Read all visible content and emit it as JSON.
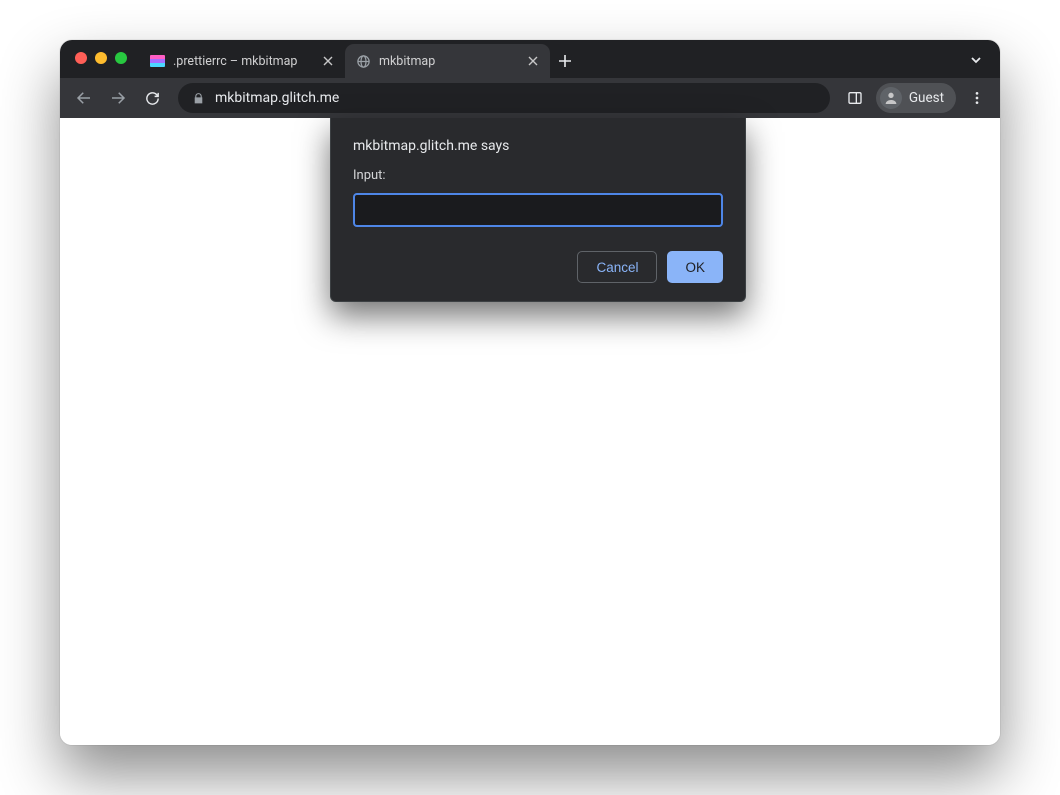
{
  "tabs": [
    {
      "label": ".prettierrc – mkbitmap",
      "active": false,
      "favicon": "glitch"
    },
    {
      "label": "mkbitmap",
      "active": true,
      "favicon": "globe"
    }
  ],
  "toolbar": {
    "url": "mkbitmap.glitch.me",
    "guest_label": "Guest"
  },
  "dialog": {
    "title": "mkbitmap.glitch.me says",
    "prompt_label": "Input:",
    "input_value": "",
    "cancel_label": "Cancel",
    "ok_label": "OK"
  }
}
